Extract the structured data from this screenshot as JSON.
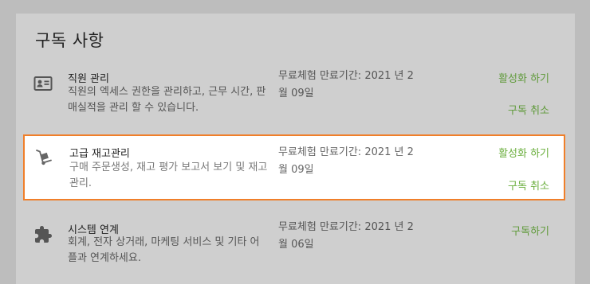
{
  "section": {
    "title": "구독 사항"
  },
  "subscriptions": [
    {
      "icon": "id-card-icon",
      "name": "직원 관리",
      "description": "직원의 엑세스 권한을 관리하고, 근무 시간, 판매실적을 관리 할 수 있습니다.",
      "trial": "무료체험 만료기간: 2021 년 2월 09일",
      "activate_label": "활성화 하기",
      "cancel_label": "구독 취소"
    },
    {
      "icon": "hand-truck-icon",
      "name": "고급 재고관리",
      "description": "구매 주문생성, 재고 평가 보고서 보기 및 재고 관리.",
      "trial": "무료체험 만료기간: 2021 년 2월 09일",
      "activate_label": "활성화 하기",
      "cancel_label": "구독 취소"
    },
    {
      "icon": "puzzle-icon",
      "name": "시스템 연계",
      "description": "회계, 전자 상거래, 마케팅 서비스 및 기타 어플과 연계하세요.",
      "trial": "무료체험 만료기간: 2021 년 2월 06일",
      "subscribe_label": "구독하기"
    }
  ],
  "colors": {
    "highlight_border": "#f07f2a",
    "action_green": "#6aae3c"
  }
}
